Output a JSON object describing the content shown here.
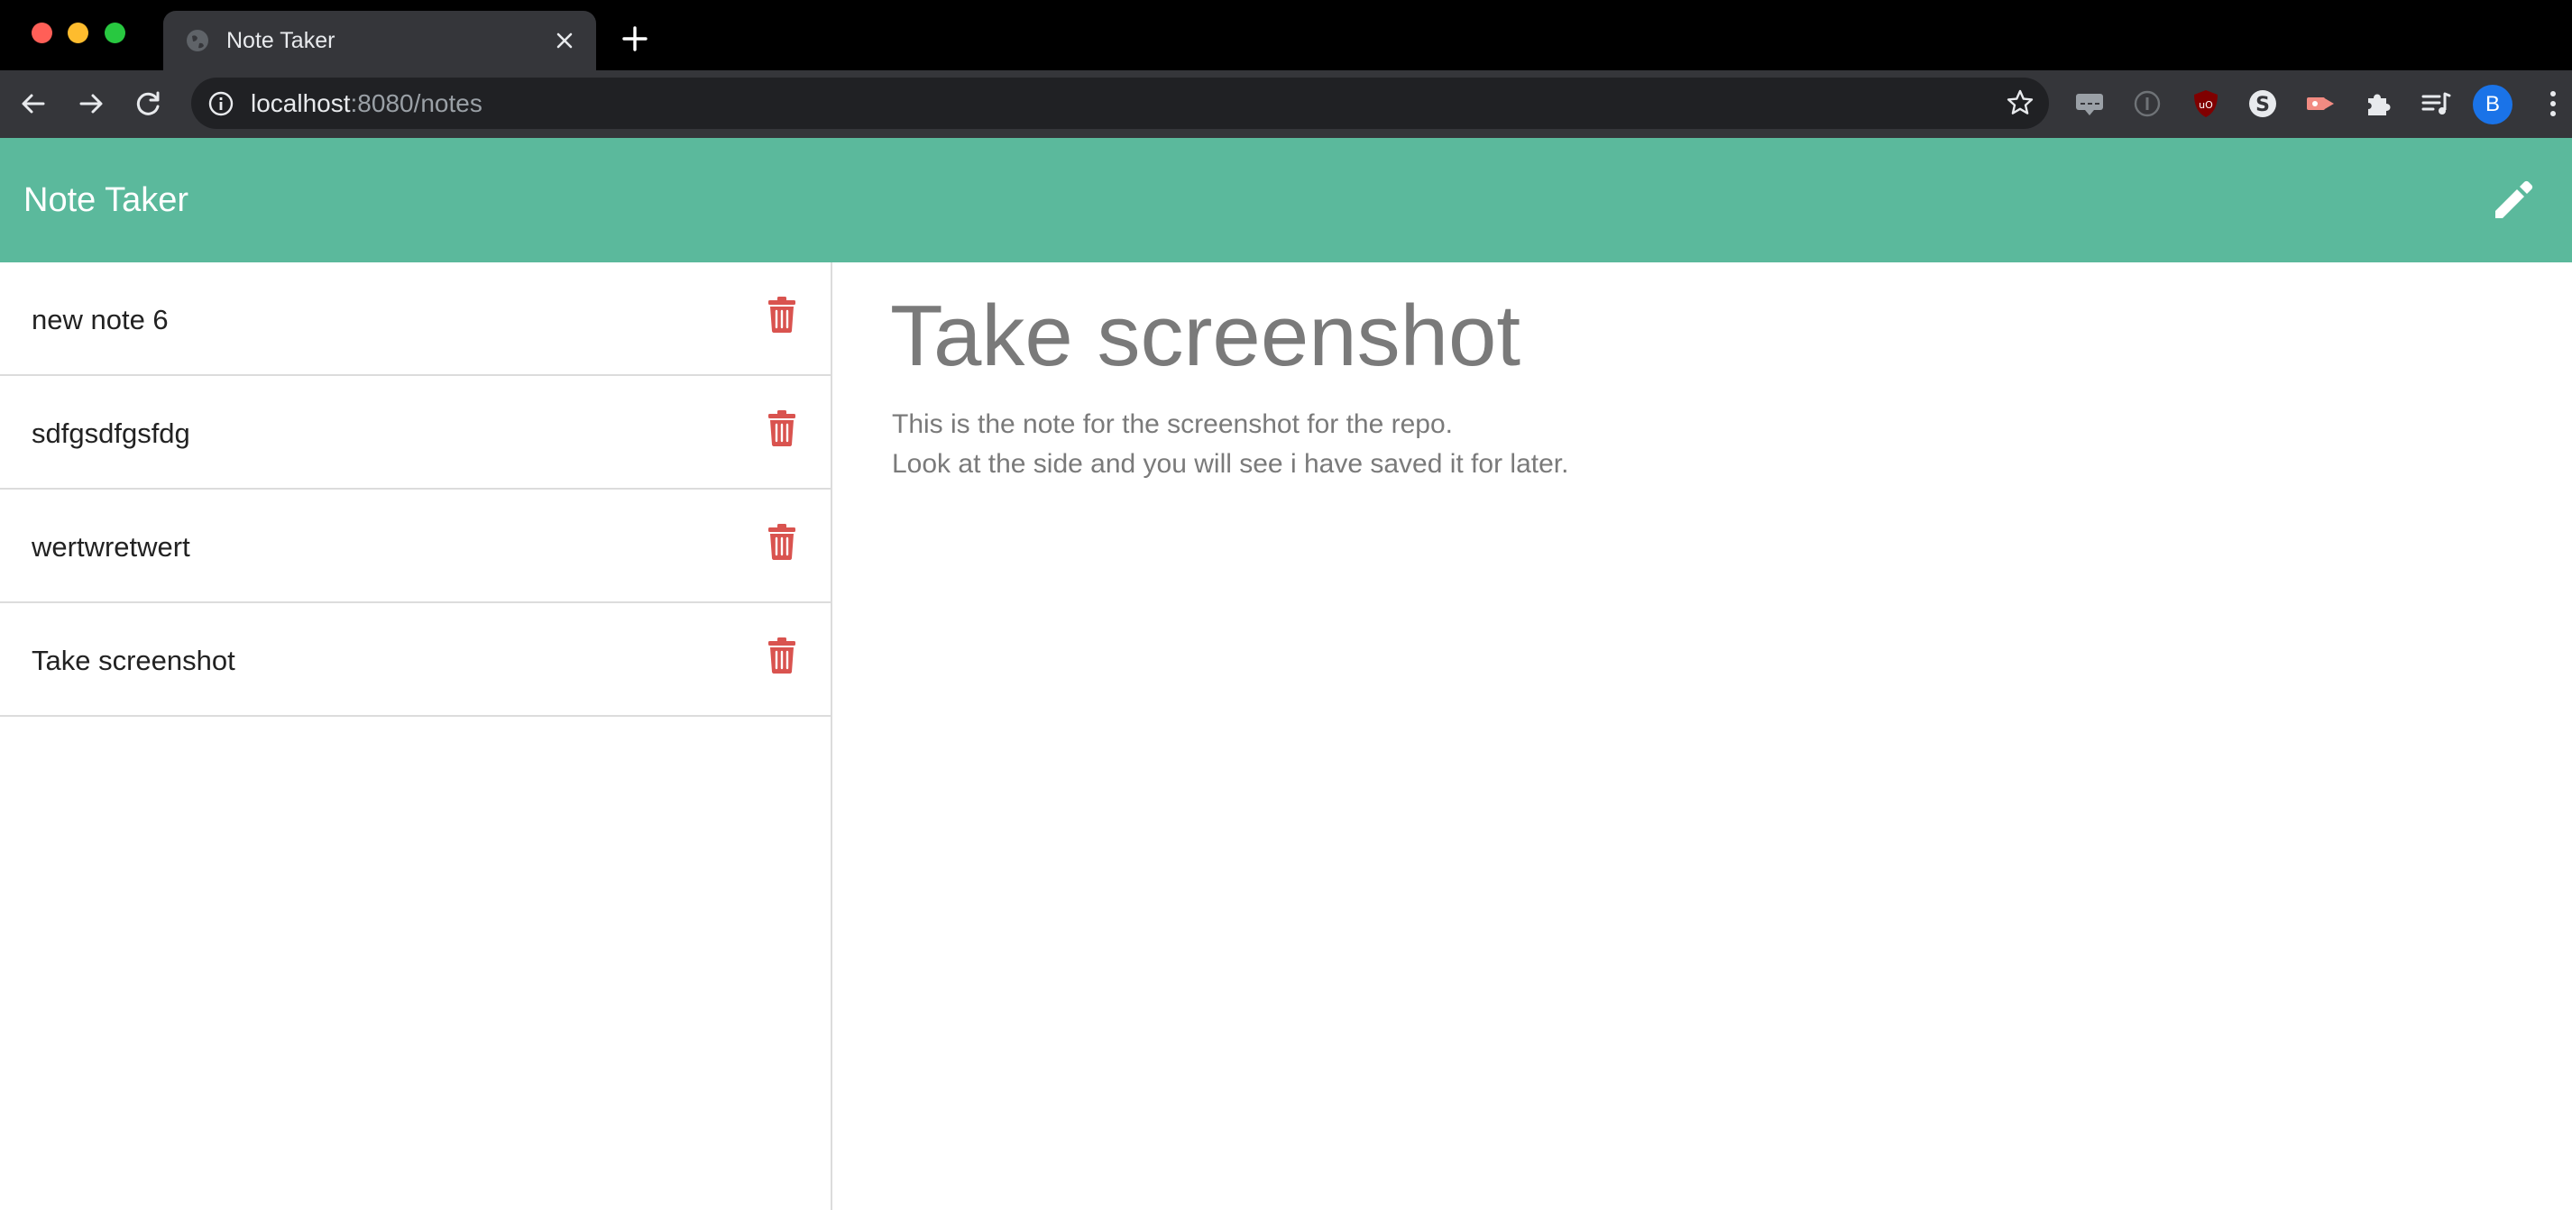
{
  "browser": {
    "tab_title": "Note Taker",
    "url_host": "localhost",
    "url_rest": ":8080/notes",
    "profile_initial": "B"
  },
  "app": {
    "title": "Note Taker",
    "accent_color": "#5bb99c",
    "delete_color": "#d9534f"
  },
  "notes": [
    {
      "title": "new note 6"
    },
    {
      "title": "sdfgsdfgsfdg"
    },
    {
      "title": "wertwretwert"
    },
    {
      "title": "Take screenshot"
    }
  ],
  "active_note": {
    "title": "Take screenshot",
    "text": "This is the note for the screenshot for the repo.\nLook at the side and you will see i have saved it for later."
  },
  "icons": {
    "tab": [
      "globe-icon",
      "close-icon",
      "plus-icon"
    ],
    "toolbar": [
      "back-arrow-icon",
      "forward-arrow-icon",
      "reload-icon",
      "info-icon",
      "star-icon",
      "css-extension-icon",
      "info-extension-icon",
      "ublock-shield-icon",
      "s-extension-icon",
      "video-extension-icon",
      "puzzle-icon",
      "media-queue-icon",
      "kebab-menu-icon"
    ],
    "app": [
      "pencil-icon",
      "trash-icon"
    ]
  }
}
